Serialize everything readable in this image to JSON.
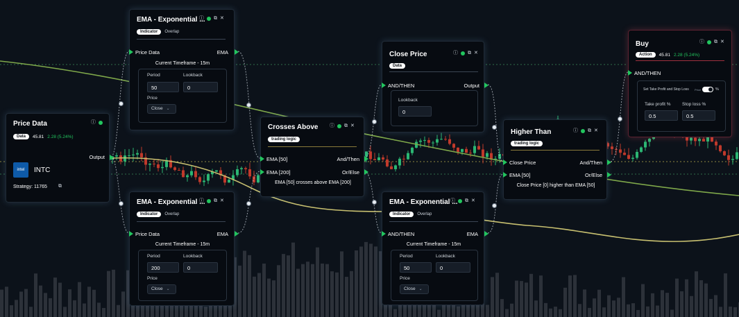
{
  "nodes": {
    "price_data": {
      "title": "Price Data",
      "badge": "Data",
      "price": "45.81",
      "change": "2.28 (5.24%)",
      "output_label": "Output",
      "ticker_logo": "intel",
      "ticker": "INTC",
      "strategy": "Strategy: 11765"
    },
    "ema1": {
      "title": "EMA - Exponential ...",
      "badge": "Indicator",
      "badge2": "Overlap",
      "input_label": "Price Data",
      "output_label": "EMA",
      "timeframe": "Current Timeframe - 15m",
      "period_label": "Period",
      "period": "50",
      "lookback_label": "Lookback",
      "lookback": "0",
      "price_label": "Price",
      "price_select": "Close"
    },
    "ema2": {
      "title": "EMA - Exponential ...",
      "badge": "Indicator",
      "badge2": "Overlap",
      "input_label": "Price Data",
      "output_label": "EMA",
      "timeframe": "Current Timeframe - 15m",
      "period_label": "Period",
      "period": "200",
      "lookback_label": "Lookback",
      "lookback": "0",
      "price_label": "Price",
      "price_select": "Close"
    },
    "crosses": {
      "title": "Crosses Above",
      "badge": "trading logic",
      "in1": "EMA [50]",
      "in2": "EMA [200]",
      "out1": "And/Then",
      "out2": "Or/Else",
      "desc": "EMA [50] crosses above EMA [200]"
    },
    "close_price": {
      "title": "Close Price",
      "badge": "Data",
      "input_label": "AND/THEN",
      "output_label": "Output",
      "lookback_label": "Lookback",
      "lookback": "0"
    },
    "ema3": {
      "title": "EMA - Exponential ...",
      "badge": "Indicator",
      "badge2": "Overlap",
      "input_label": "AND/THEN",
      "output_label": "EMA",
      "timeframe": "Current Timeframe - 15m",
      "period_label": "Period",
      "period": "50",
      "lookback_label": "Lookback",
      "lookback": "0",
      "price_label": "Price",
      "price_select": "Close"
    },
    "higher": {
      "title": "Higher Than",
      "badge": "trading logic",
      "in1": "Close Price",
      "in2": "EMA [50]",
      "out1": "And/Then",
      "out2": "Or/Else",
      "desc": "Close Price [0] higher than EMA [50]"
    },
    "buy": {
      "title": "Buy",
      "badge": "Action",
      "price": "45.81",
      "change": "2.28 (5.24%)",
      "input_label": "AND/THEN",
      "tp_sl_label": "Set Take Profit and Stop Loss",
      "toggle_left": "Price",
      "toggle_right": "%",
      "tp_label": "Take profit %",
      "tp_value": "0.5",
      "sl_label": "Stop loss %",
      "sl_value": "0.5"
    }
  },
  "colors": {
    "accent_green": "#22c55e",
    "candle_up": "#2bb673",
    "candle_down": "#c0392b",
    "ema_line": "#8fb050",
    "ema_slow_line": "#c8c070",
    "buy_border": "#a0303e",
    "logic_underline": "#8a7a3b"
  },
  "icons": [
    "info-icon",
    "status-dot-icon",
    "copy-icon",
    "close-icon",
    "input-arrow-icon",
    "output-arrow-icon",
    "connector-handle-icon",
    "toggle-icon",
    "chevron-down-icon"
  ]
}
